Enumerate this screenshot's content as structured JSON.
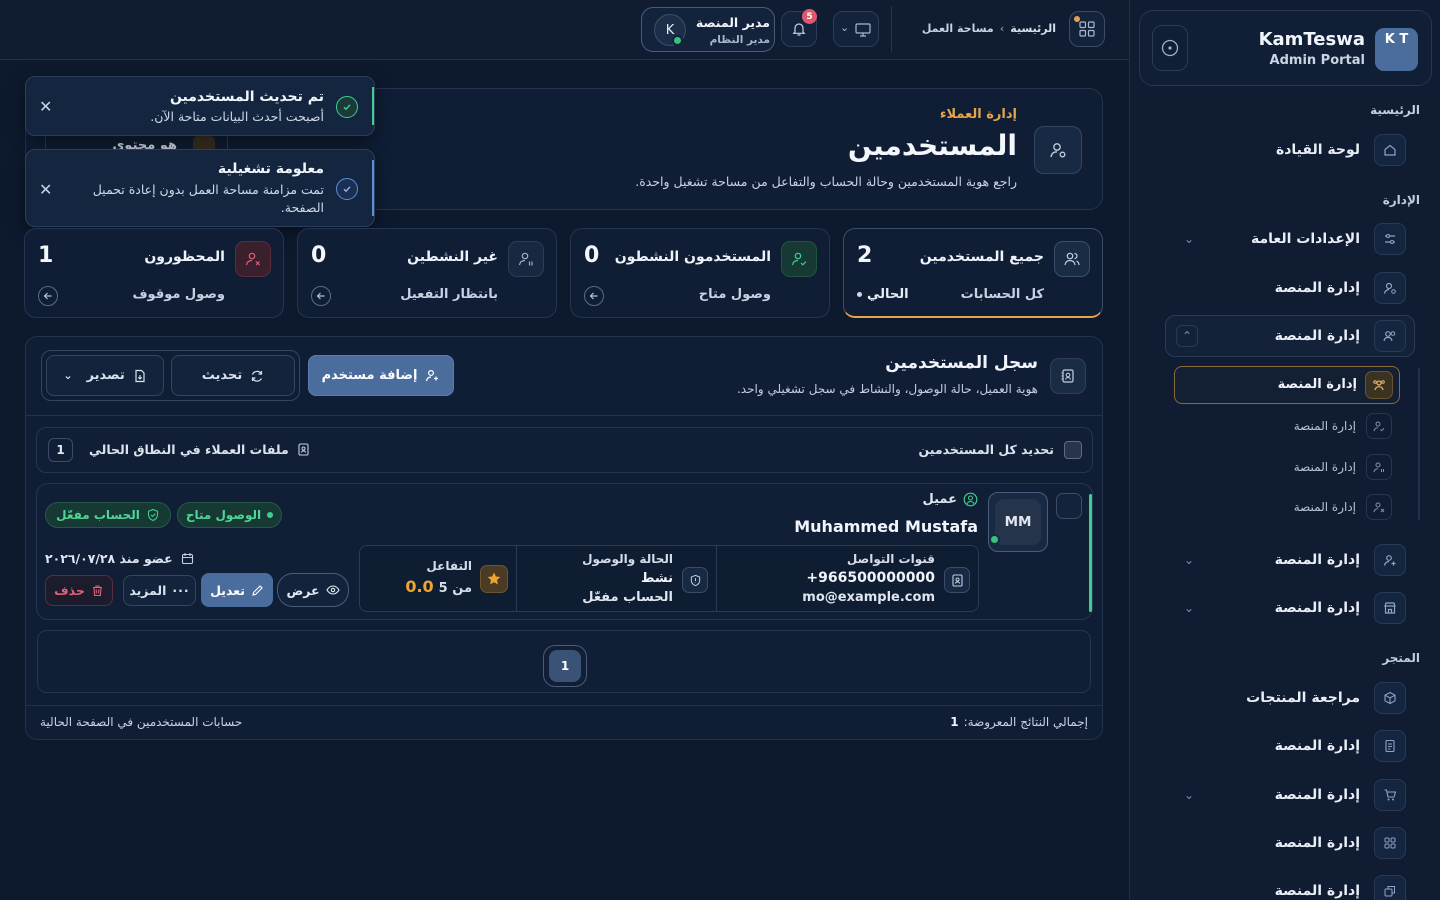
{
  "brand": {
    "logo_text": "K T",
    "name": "KamTeswa",
    "subtitle": "Admin Portal"
  },
  "sidebar": {
    "sections": {
      "home": "الرئيسية",
      "admin": "الإدارة",
      "store": "المتجر"
    },
    "dashboard": "لوحة القيادة",
    "general_settings": "الإعدادات العامة",
    "platform_mgmt_1": "إدارة المنصة",
    "platform_mgmt_group": "إدارة المنصة",
    "sub_active": "إدارة المنصة",
    "sub_items": [
      "إدارة المنصة",
      "إدارة المنصة",
      "إدارة المنصة"
    ],
    "platform_mgmt_2": "إدارة المنصة",
    "platform_mgmt_3": "إدارة المنصة",
    "product_review": "مراجعة المنتجات",
    "store_items": [
      "إدارة المنصة",
      "إدارة المنصة",
      "إدارة المنصة",
      "إدارة المنصة"
    ]
  },
  "topbar": {
    "breadcrumb_home": "الرئيسية",
    "breadcrumb_sep": "›",
    "breadcrumb_current": "مساحة العمل",
    "notifications_count": "5",
    "user_name": "مدير المنصة",
    "user_role": "مدير النظام",
    "user_initial": "K"
  },
  "header": {
    "eyebrow": "إدارة العملاء",
    "title": "المستخدمين",
    "description": "راجع هوية المستخدمين وحالة الحساب والتفاعل من مساحة تشغيل واحدة.",
    "hidden_chip": "هو محتوى"
  },
  "toasts": [
    {
      "title": "تم تحديث المستخدمين",
      "message": "أصبحت أحدث البيانات متاحة الآن."
    },
    {
      "title": "معلومة تشغيلية",
      "message": "تمت مزامنة مساحة العمل بدون إعادة تحميل الصفحة."
    }
  ],
  "stats": [
    {
      "title": "جميع المستخدمين",
      "value": "2",
      "subtitle": "كل الحسابات",
      "tag": "الحالي"
    },
    {
      "title": "المستخدمون النشطون",
      "value": "0",
      "subtitle": "وصول متاح"
    },
    {
      "title": "غير النشطين",
      "value": "0",
      "subtitle": "بانتظار التفعيل"
    },
    {
      "title": "المحظورون",
      "value": "1",
      "subtitle": "وصول موقوف"
    }
  ],
  "registry": {
    "title": "سجل المستخدمين",
    "subtitle": "هوية العميل، حالة الوصول، والنشاط في سجل تشغيلي واحد.",
    "add_user": "إضافة مستخدم",
    "refresh": "تحديث",
    "export": "تصدير",
    "select_all": "تحديد كل المستخدمين",
    "files_in_scope": "ملفات العملاء في النطاق الحالي",
    "files_count": "1"
  },
  "user_row": {
    "initials": "MM",
    "role": "عميل",
    "name": "Muhammed Mustafa",
    "badge_access": "الوصول متاح",
    "badge_account": "الحساب مفعّل",
    "member_since": "عضو منذ ٢٠٢٦/٠٧/٢٨",
    "contact_label": "قنوات التواصل",
    "phone": "+966500000000",
    "email": "mo@example.com",
    "status_label": "الحالة والوصول",
    "status_value": "نشط",
    "status_account": "الحساب مفعّل",
    "engagement_label": "التفاعل",
    "rating": "0.0",
    "rating_of": "من 5",
    "view": "عرض",
    "edit": "تعديل",
    "more": "المزيد",
    "delete": "حذف"
  },
  "pagination": {
    "current": "1"
  },
  "footer": {
    "total_label": "إجمالي النتائج المعروضة:",
    "total_value": "1",
    "note": "حسابات المستخدمين في الصفحة الحالية"
  },
  "colors": {
    "accent": "#4a6d9e",
    "success": "#3ecf8e",
    "warning": "#e6b46a",
    "danger": "#e0607a"
  }
}
